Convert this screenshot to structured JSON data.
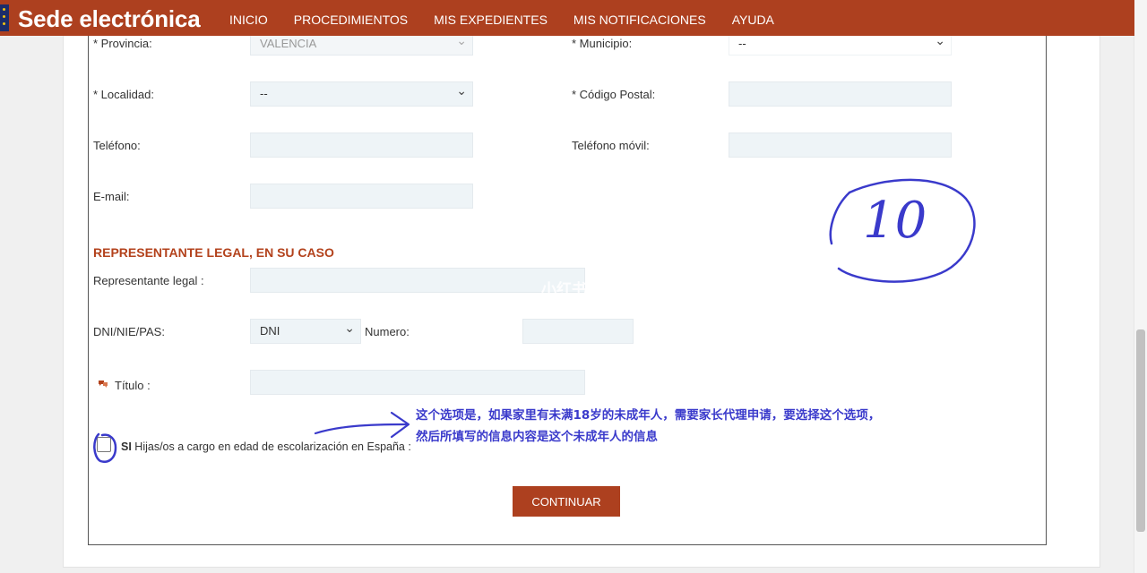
{
  "header": {
    "brand": "Sede electrónica",
    "nav": [
      "INICIO",
      "PROCEDIMIENTOS",
      "MIS EXPEDIENTES",
      "MIS NOTIFICACIONES",
      "AYUDA"
    ]
  },
  "form": {
    "provincia": {
      "label": "* Provincia:",
      "value": "VALENCIA"
    },
    "municipio": {
      "label": "* Municipio:",
      "value": "--"
    },
    "localidad": {
      "label": "* Localidad:",
      "value": "--"
    },
    "codigo_postal": {
      "label": "* Código Postal:",
      "value": ""
    },
    "telefono": {
      "label": "Teléfono:",
      "value": ""
    },
    "telefono_movil": {
      "label": "Teléfono móvil:",
      "value": ""
    },
    "email": {
      "label": "E-mail:",
      "value": ""
    }
  },
  "representante": {
    "title": "REPRESENTANTE LEGAL, EN SU CASO",
    "rep_legal_label": "Representante legal :",
    "dni_label": "DNI/NIE/PAS:",
    "dni_value": "DNI",
    "numero_label": "Numero:",
    "titulo_label": "Título :"
  },
  "checkbox": {
    "si": "SI",
    "label": "Hijas/os a cargo en edad de escolarización en España :"
  },
  "continue_label": "CONTINUAR",
  "annotations": {
    "note": "这个选项是，如果家里有未满18岁的未成年人，需要家长代理申请，要选择这个选项，然后所填写的信息内容是这个未成年人的信息",
    "circled_number": "10",
    "watermark": "小红书"
  },
  "colors": {
    "brand": "#ad401f",
    "annotation": "#3a3acb",
    "field_bg": "#eef4f7"
  }
}
